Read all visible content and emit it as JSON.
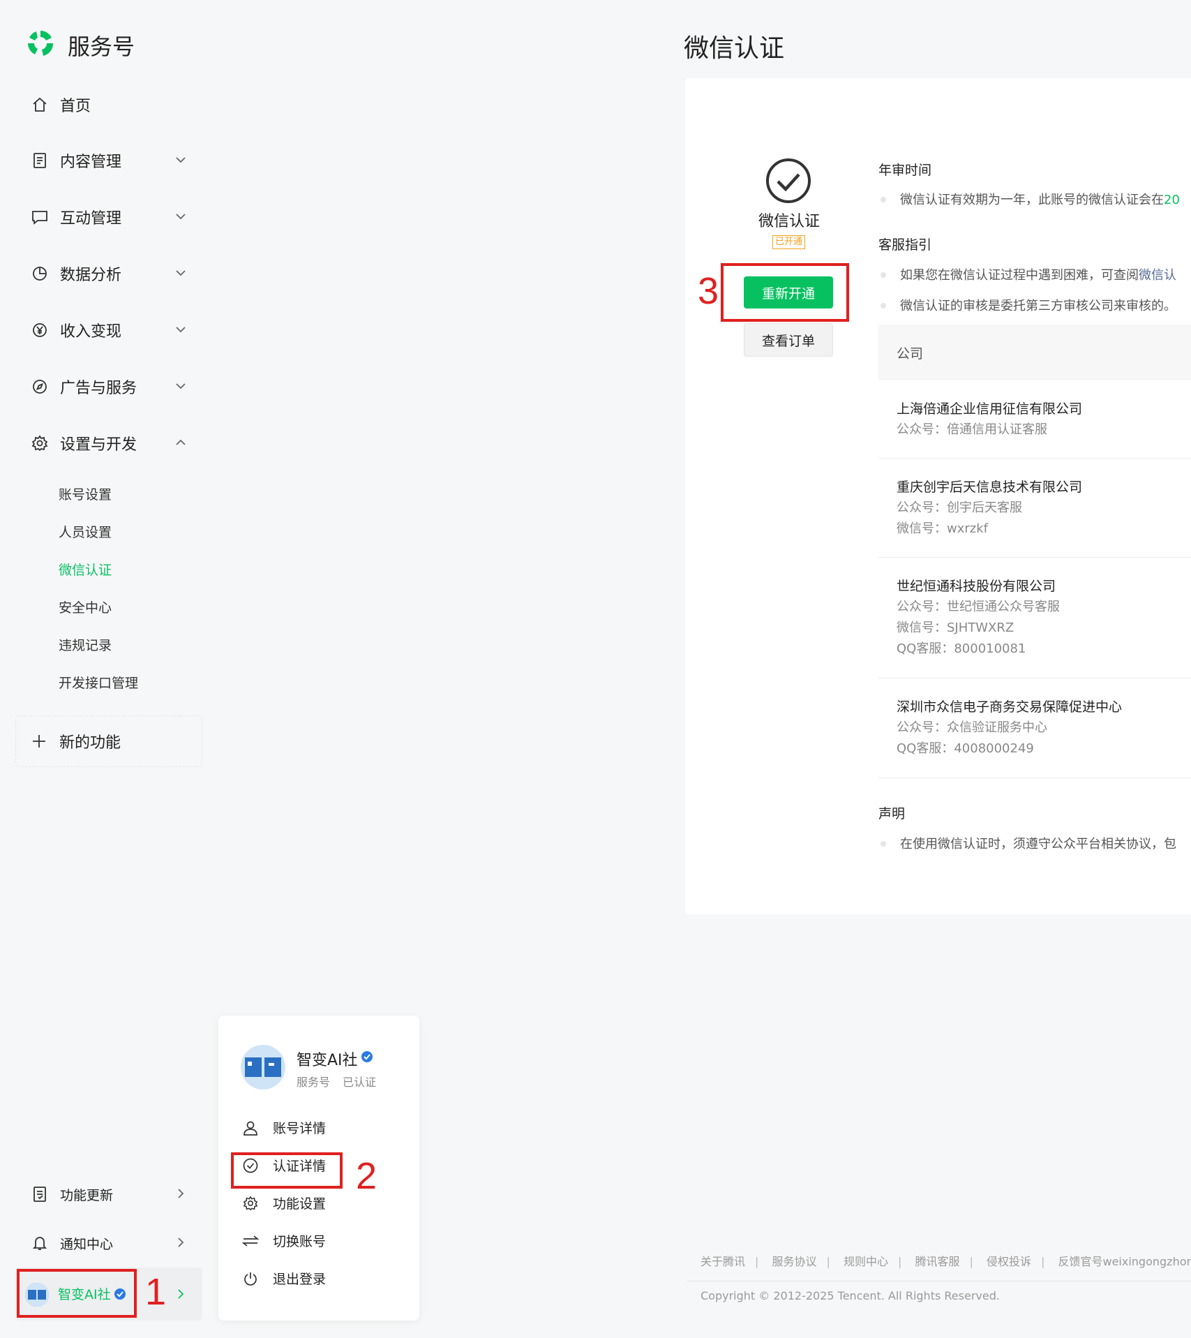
{
  "app": {
    "name": "服务号"
  },
  "nav": {
    "items": [
      {
        "label": "首页"
      },
      {
        "label": "内容管理"
      },
      {
        "label": "互动管理"
      },
      {
        "label": "数据分析"
      },
      {
        "label": "收入变现"
      },
      {
        "label": "广告与服务"
      },
      {
        "label": "设置与开发"
      }
    ],
    "sub_items": [
      {
        "label": "账号设置"
      },
      {
        "label": "人员设置"
      },
      {
        "label": "微信认证"
      },
      {
        "label": "安全中心"
      },
      {
        "label": "违规记录"
      },
      {
        "label": "开发接口管理"
      }
    ],
    "new_feature": "新的功能",
    "bottom": [
      {
        "label": "功能更新"
      },
      {
        "label": "通知中心"
      }
    ],
    "account_name": "智变AI社"
  },
  "annotations": [
    "1",
    "2",
    "3"
  ],
  "popup": {
    "name": "智变AI社",
    "type": "服务号",
    "status": "已认证",
    "items": [
      {
        "label": "账号详情"
      },
      {
        "label": "认证详情"
      },
      {
        "label": "功能设置"
      },
      {
        "label": "切换账号"
      },
      {
        "label": "退出登录"
      }
    ]
  },
  "main": {
    "title": "微信认证",
    "cert": {
      "label": "微信认证",
      "badge": "已开通",
      "reopen_button": "重新开通",
      "order_button": "查看订单"
    },
    "annual": {
      "title": "年审时间",
      "text": "微信认证有效期为一年，此账号的微信认证会在",
      "highlight": "20"
    },
    "support": {
      "title": "客服指引",
      "line1_text": "如果您在微信认证过程中遇到困难，可查阅",
      "line1_link": "微信认",
      "line2_text": "微信认证的审核是委托第三方审核公司来审核的。"
    },
    "table": {
      "header": "公司",
      "companies": [
        {
          "name": "上海倍通企业信用征信有限公司",
          "lines": [
            "公众号：倍通信用认证客服"
          ]
        },
        {
          "name": "重庆创宇后天信息技术有限公司",
          "lines": [
            "公众号：创宇后天客服",
            "微信号：wxrzkf"
          ]
        },
        {
          "name": "世纪恒通科技股份有限公司",
          "lines": [
            "公众号：世纪恒通公众号客服",
            "微信号：SJHTWXRZ",
            "QQ客服：800010081"
          ]
        },
        {
          "name": "深圳市众信电子商务交易保障促进中心",
          "lines": [
            "公众号：众信验证服务中心",
            "QQ客服：4008000249"
          ]
        }
      ]
    },
    "statement": {
      "title": "声明",
      "text": "在使用微信认证时，须遵守公众平台相关协议，包"
    }
  },
  "footer": {
    "links": [
      "关于腾讯",
      "服务协议",
      "规则中心",
      "腾讯客服",
      "侵权投诉",
      "反馈官号weixingongzhon"
    ],
    "copyright": "Copyright © 2012-2025 Tencent. All Rights Reserved."
  },
  "colors": {
    "accent": "#07c160",
    "annotation": "#e02020",
    "badge": "#f0a020",
    "link": "#576b95"
  }
}
